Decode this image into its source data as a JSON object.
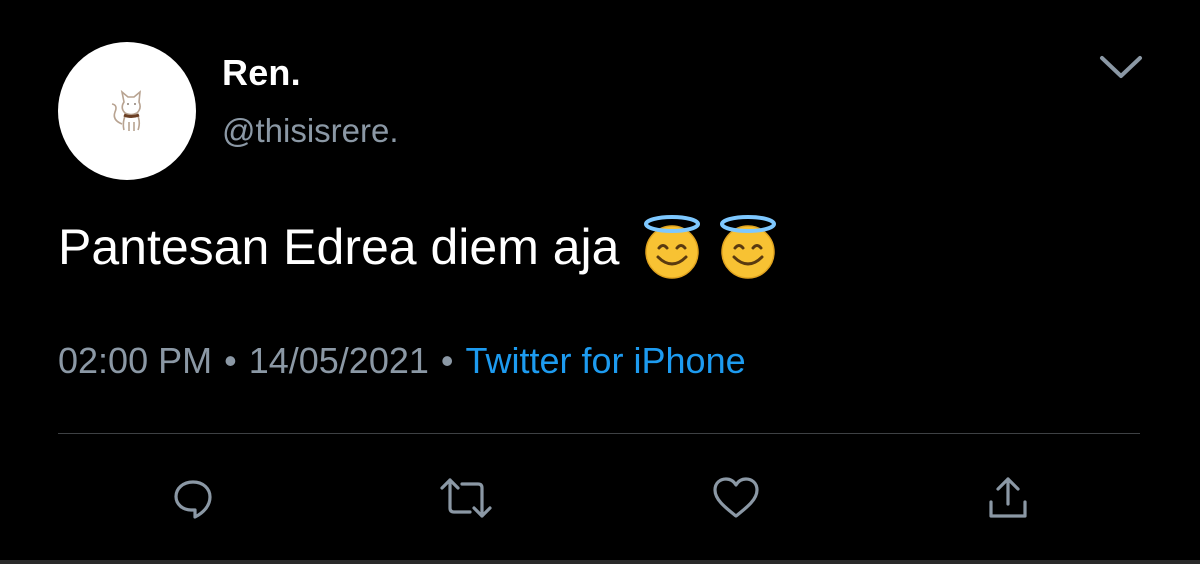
{
  "tweet": {
    "display_name": "Ren.",
    "handle": "@thisisrere.",
    "text": "Pantesan Edrea diem aja",
    "emojis": [
      "smiling-face-with-halo",
      "smiling-face-with-halo"
    ],
    "time": "02:00 PM",
    "separator": "•",
    "date": "14/05/2021",
    "source": "Twitter for iPhone"
  },
  "actions": {
    "reply_icon": "reply-icon",
    "retweet_icon": "retweet-icon",
    "like_icon": "heart-icon",
    "share_icon": "share-icon"
  },
  "colors": {
    "background": "#000000",
    "text_primary": "#ffffff",
    "text_secondary": "#8b98a5",
    "link": "#1d9bf0",
    "divider": "#3e4144"
  }
}
